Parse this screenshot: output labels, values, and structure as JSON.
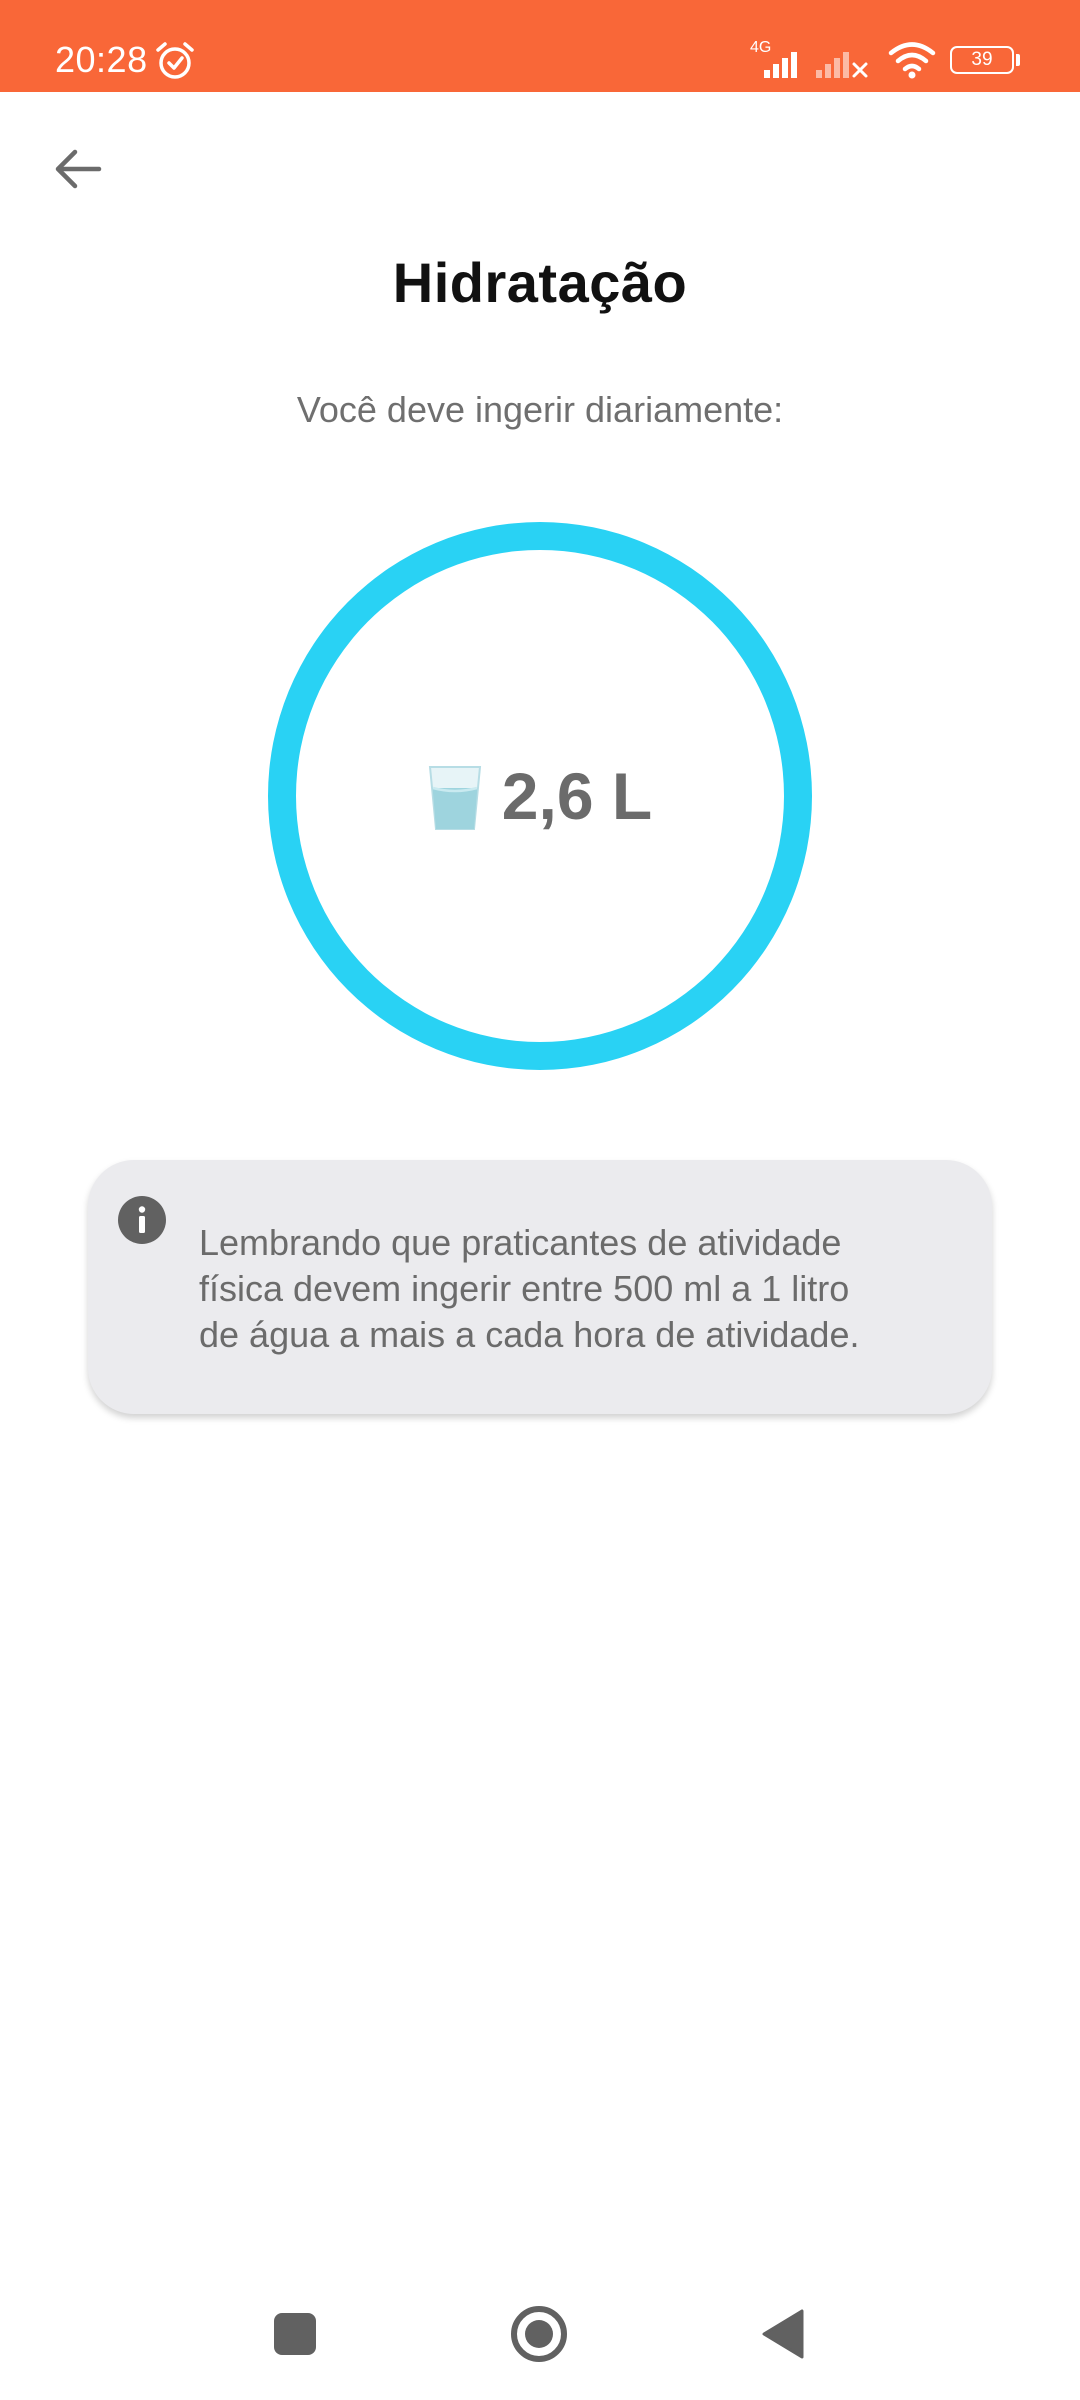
{
  "status_bar": {
    "time": "20:28",
    "network_type": "4G",
    "battery_level": "39",
    "background_color": "#f96738",
    "icons": [
      "alarm-icon",
      "signal-icon",
      "signal-no-service-icon",
      "wifi-icon",
      "battery-icon"
    ]
  },
  "header": {
    "back_icon": "arrow-left-icon",
    "title": "Hidratação"
  },
  "main": {
    "subtitle": "Você deve ingerir diariamente:",
    "ring_color": "#29d2f4",
    "glass_icon": "water-glass-icon",
    "daily_amount": "2,6 L"
  },
  "info_card": {
    "icon": "info-icon",
    "text": "Lembrando que praticantes de atividade\nfísica devem ingerir entre 500 ml a 1 litro\nde água a mais a cada hora de atividade."
  },
  "navigation_bar": {
    "icons": [
      "recents-square-icon",
      "home-circle-icon",
      "back-triangle-icon"
    ]
  }
}
